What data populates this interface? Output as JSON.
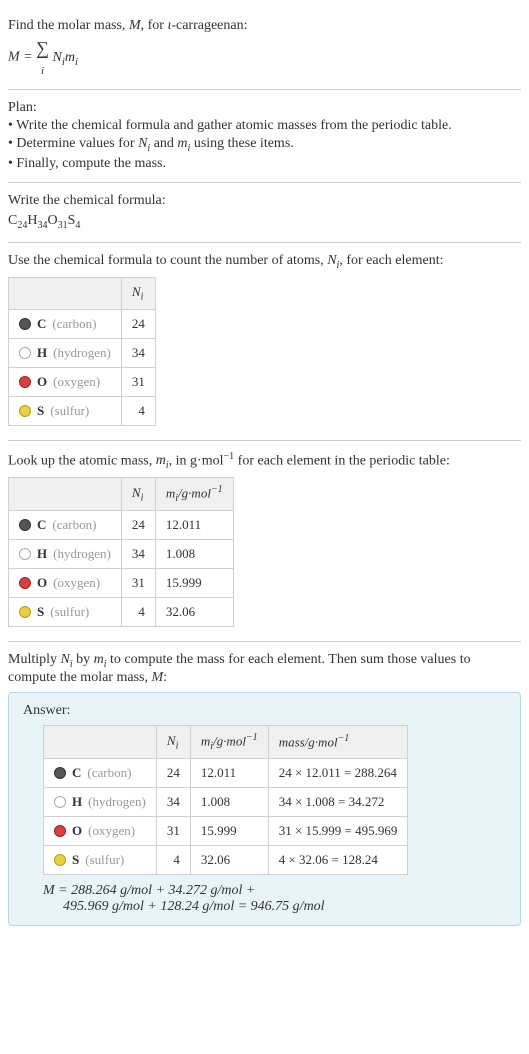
{
  "intro": {
    "line1_a": "Find the molar mass, ",
    "line1_b": ", for ",
    "line1_c": "-carrageenan:",
    "M": "M",
    "iota": "ι",
    "formula_lhs": "M",
    "formula_sum": "∑",
    "formula_idx": "i",
    "formula_rhs_a": "N",
    "formula_rhs_b": "m"
  },
  "plan": {
    "title": "Plan:",
    "b1_a": "• Write the chemical formula and gather atomic masses from the periodic table.",
    "b2_a": "• Determine values for ",
    "b2_b": " and ",
    "b2_c": " using these items.",
    "Ni_a": "N",
    "Ni_b": "i",
    "mi_a": "m",
    "mi_b": "i",
    "b3": "• Finally, compute the mass."
  },
  "chem": {
    "title": "Write the chemical formula:",
    "C": "C",
    "C_n": "24",
    "H": "H",
    "H_n": "34",
    "O": "O",
    "O_n": "31",
    "S": "S",
    "S_n": "4"
  },
  "atoms": {
    "title_a": "Use the chemical formula to count the number of atoms, ",
    "title_b": ", for each element:",
    "Ni_a": "N",
    "Ni_b": "i",
    "hdr_ni": "N",
    "hdr_ni_sub": "i",
    "rows": [
      {
        "sym": "C",
        "name": "(carbon)",
        "ni": "24",
        "dot": "dot-carbon"
      },
      {
        "sym": "H",
        "name": "(hydrogen)",
        "ni": "34",
        "dot": "dot-hydrogen"
      },
      {
        "sym": "O",
        "name": "(oxygen)",
        "ni": "31",
        "dot": "dot-oxygen"
      },
      {
        "sym": "S",
        "name": "(sulfur)",
        "ni": "4",
        "dot": "dot-sulfur"
      }
    ]
  },
  "masses": {
    "title_a": "Look up the atomic mass, ",
    "title_b": ", in g·mol",
    "title_c": " for each element in the periodic table:",
    "mi_a": "m",
    "mi_b": "i",
    "neg1": "−1",
    "hdr_ni": "N",
    "hdr_ni_sub": "i",
    "hdr_mi_a": "m",
    "hdr_mi_b": "i",
    "hdr_mi_c": "/g·mol",
    "rows": [
      {
        "sym": "C",
        "name": "(carbon)",
        "ni": "24",
        "mi": "12.011",
        "dot": "dot-carbon"
      },
      {
        "sym": "H",
        "name": "(hydrogen)",
        "ni": "34",
        "mi": "1.008",
        "dot": "dot-hydrogen"
      },
      {
        "sym": "O",
        "name": "(oxygen)",
        "ni": "31",
        "mi": "15.999",
        "dot": "dot-oxygen"
      },
      {
        "sym": "S",
        "name": "(sulfur)",
        "ni": "4",
        "mi": "32.06",
        "dot": "dot-sulfur"
      }
    ]
  },
  "final": {
    "title_a": "Multiply ",
    "title_b": " by ",
    "title_c": " to compute the mass for each element. Then sum those values to compute the molar mass, ",
    "title_d": ":",
    "Ni_a": "N",
    "Ni_b": "i",
    "mi_a": "m",
    "mi_b": "i",
    "M": "M",
    "answer": "Answer:",
    "hdr_ni": "N",
    "hdr_ni_sub": "i",
    "hdr_mi_a": "m",
    "hdr_mi_b": "i",
    "hdr_mi_c": "/g·mol",
    "hdr_mass": "mass/g·mol",
    "neg1": "−1",
    "rows": [
      {
        "sym": "C",
        "name": "(carbon)",
        "ni": "24",
        "mi": "12.011",
        "mass": "24 × 12.011 = 288.264",
        "dot": "dot-carbon"
      },
      {
        "sym": "H",
        "name": "(hydrogen)",
        "ni": "34",
        "mi": "1.008",
        "mass": "34 × 1.008 = 34.272",
        "dot": "dot-hydrogen"
      },
      {
        "sym": "O",
        "name": "(oxygen)",
        "ni": "31",
        "mi": "15.999",
        "mass": "31 × 15.999 = 495.969",
        "dot": "dot-oxygen"
      },
      {
        "sym": "S",
        "name": "(sulfur)",
        "ni": "4",
        "mi": "32.06",
        "mass": "4 × 32.06 = 128.24",
        "dot": "dot-sulfur"
      }
    ],
    "eq_line1": "M = 288.264 g/mol + 34.272 g/mol +",
    "eq_line2": "495.969 g/mol + 128.24 g/mol = 946.75 g/mol"
  }
}
